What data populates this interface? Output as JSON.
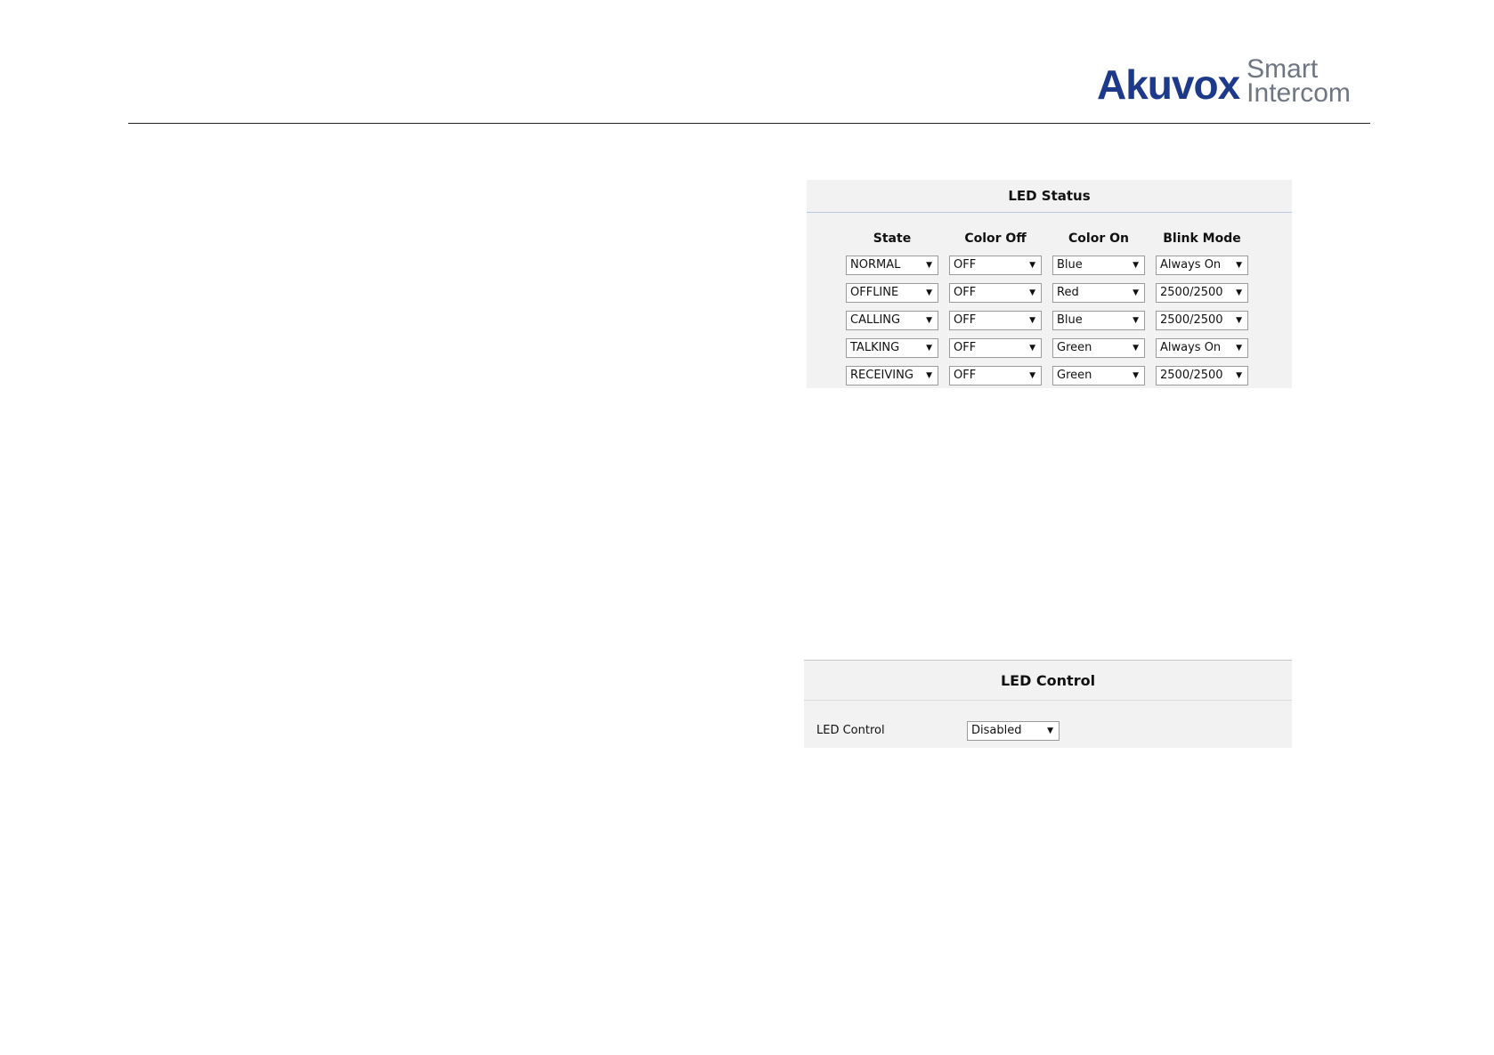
{
  "header": {
    "brand": "Akuvox",
    "tagline_line1": "Smart",
    "tagline_line2": "Intercom",
    "brand_color": "#1d3a8a",
    "tagline_color": "#6f7682"
  },
  "led_status": {
    "title": "LED Status",
    "columns": [
      "State",
      "Color Off",
      "Color On",
      "Blink Mode"
    ],
    "rows": [
      [
        "NORMAL",
        "OFF",
        "Blue",
        "Always On"
      ],
      [
        "OFFLINE",
        "OFF",
        "Red",
        "2500/2500"
      ],
      [
        "CALLING",
        "OFF",
        "Blue",
        "2500/2500"
      ],
      [
        "TALKING",
        "OFF",
        "Green",
        "Always On"
      ],
      [
        "RECEIVING",
        "OFF",
        "Green",
        "2500/2500"
      ]
    ]
  },
  "led_control": {
    "title": "LED Control",
    "label": "LED Control",
    "value": "Disabled"
  },
  "icons": {
    "dropdown": "caret-down-icon"
  }
}
